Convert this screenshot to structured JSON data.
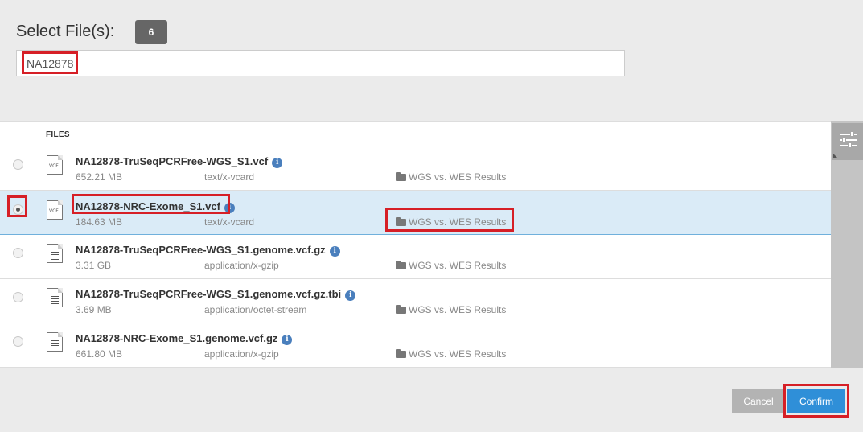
{
  "header": {
    "title": "Select File(s):",
    "count": "6"
  },
  "search": {
    "value": "NA12878"
  },
  "table": {
    "header": "FILES",
    "rows": [
      {
        "name": "NA12878-TruSeqPCRFree-WGS_S1.vcf",
        "size": "652.21 MB",
        "type": "text/x-vcard",
        "folder": "WGS vs. WES Results",
        "icon": "vcf-file-icon",
        "icon_text": "VCF",
        "selected": false
      },
      {
        "name": "NA12878-NRC-Exome_S1.vcf",
        "size": "184.63 MB",
        "type": "text/x-vcard",
        "folder": "WGS vs. WES Results",
        "icon": "vcf-file-icon",
        "icon_text": "VCF",
        "selected": true
      },
      {
        "name": "NA12878-TruSeqPCRFree-WGS_S1.genome.vcf.gz",
        "size": "3.31 GB",
        "type": "application/x-gzip",
        "folder": "WGS vs. WES Results",
        "icon": "document-icon",
        "selected": false
      },
      {
        "name": "NA12878-TruSeqPCRFree-WGS_S1.genome.vcf.gz.tbi",
        "size": "3.69 MB",
        "type": "application/octet-stream",
        "folder": "WGS vs. WES Results",
        "icon": "document-icon",
        "selected": false
      },
      {
        "name": "NA12878-NRC-Exome_S1.genome.vcf.gz",
        "size": "661.80 MB",
        "type": "application/x-gzip",
        "folder": "WGS vs. WES Results",
        "icon": "document-icon",
        "selected": false
      }
    ]
  },
  "info_symbol": "i",
  "buttons": {
    "cancel": "Cancel",
    "confirm": "Confirm"
  },
  "colors": {
    "highlight": "#d61f26",
    "confirm": "#2f8fd8",
    "selected_row": "#daebf7"
  }
}
